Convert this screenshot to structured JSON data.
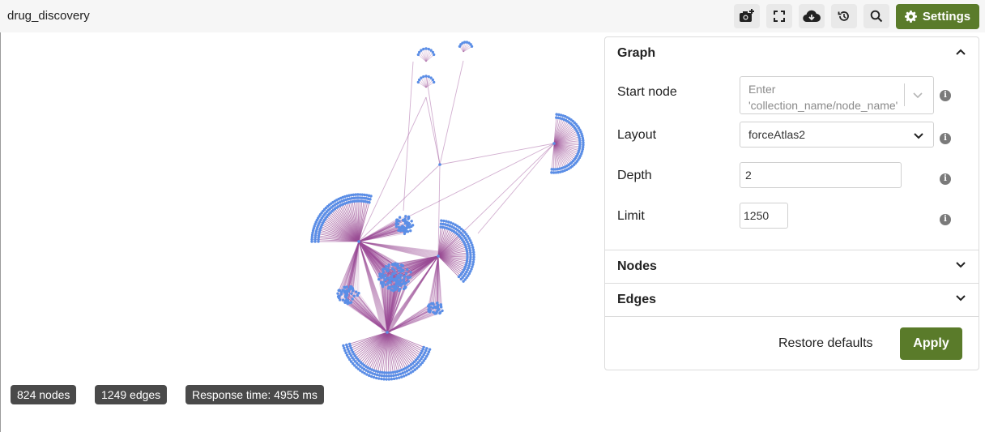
{
  "header": {
    "title": "drug_discovery",
    "settings_label": "Settings",
    "icons": [
      "camera-plus-icon",
      "fullscreen-icon",
      "cloud-download-icon",
      "history-icon",
      "search-icon",
      "gear-icon"
    ]
  },
  "stats": {
    "nodes": "824 nodes",
    "edges": "1249 edges",
    "response_time": "Response time: 4955 ms"
  },
  "panel": {
    "graph_section": "Graph",
    "nodes_section": "Nodes",
    "edges_section": "Edges",
    "start_node_label": "Start node",
    "start_node_placeholder": "Enter 'collection_name/node_name'",
    "layout_label": "Layout",
    "layout_value": "forceAtlas2",
    "depth_label": "Depth",
    "depth_value": "2",
    "limit_label": "Limit",
    "limit_value": "1250",
    "restore_label": "Restore defaults",
    "apply_label": "Apply"
  },
  "colors": {
    "accent": "#5a7b2a",
    "node": "#5b8ee6",
    "edge": "#9b4d96"
  }
}
